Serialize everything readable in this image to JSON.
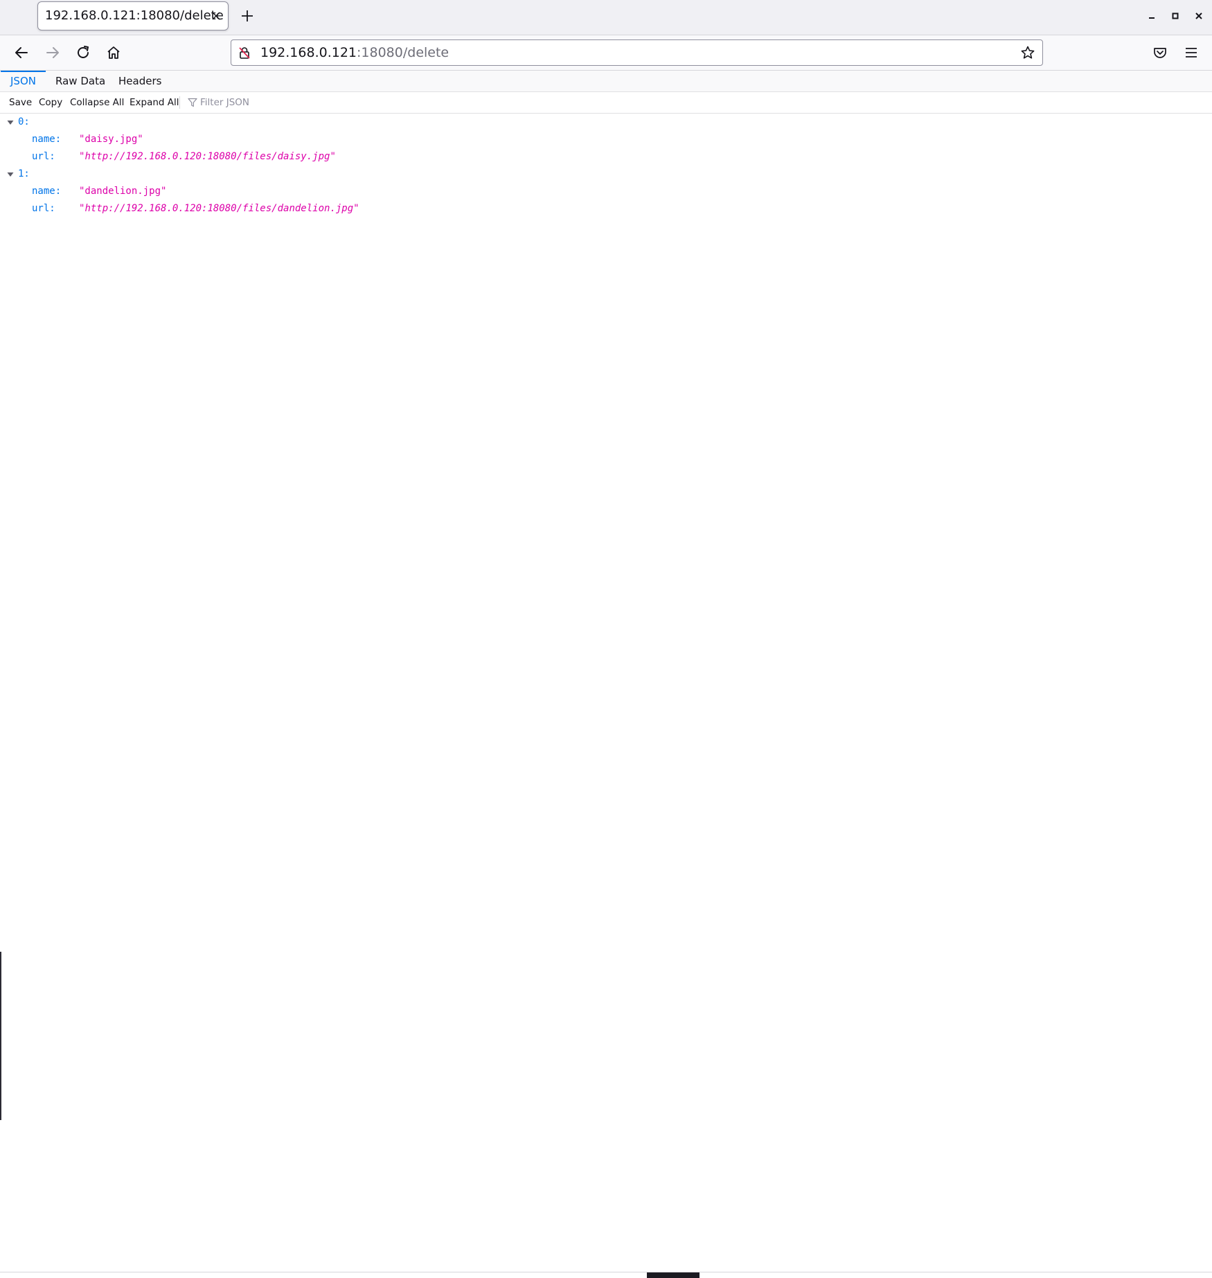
{
  "browser": {
    "tab_title": "192.168.0.121:18080/delete",
    "url_host": "192.168.0.121",
    "url_path": ":18080/delete"
  },
  "viewer": {
    "tabs": [
      {
        "label": "JSON",
        "active": true
      },
      {
        "label": "Raw Data",
        "active": false
      },
      {
        "label": "Headers",
        "active": false
      }
    ],
    "toolbar": {
      "save_label": "Save",
      "copy_label": "Copy",
      "collapse_label": "Collapse All",
      "expand_label": "Expand All",
      "filter_placeholder": "Filter JSON"
    }
  },
  "json": {
    "items": [
      {
        "index": "0:",
        "name_key": "name:",
        "name_value": "\"daisy.jpg\"",
        "url_key": "url:",
        "url_value": "http://192.168.0.120:18080/files/daisy.jpg"
      },
      {
        "index": "1:",
        "name_key": "name:",
        "name_value": "\"dandelion.jpg\"",
        "url_key": "url:",
        "url_value": "http://192.168.0.120:18080/files/dandelion.jpg"
      }
    ]
  },
  "colors": {
    "accent": "#0074e8",
    "json_key": "#0074e8",
    "json_string": "#dd00a9"
  }
}
